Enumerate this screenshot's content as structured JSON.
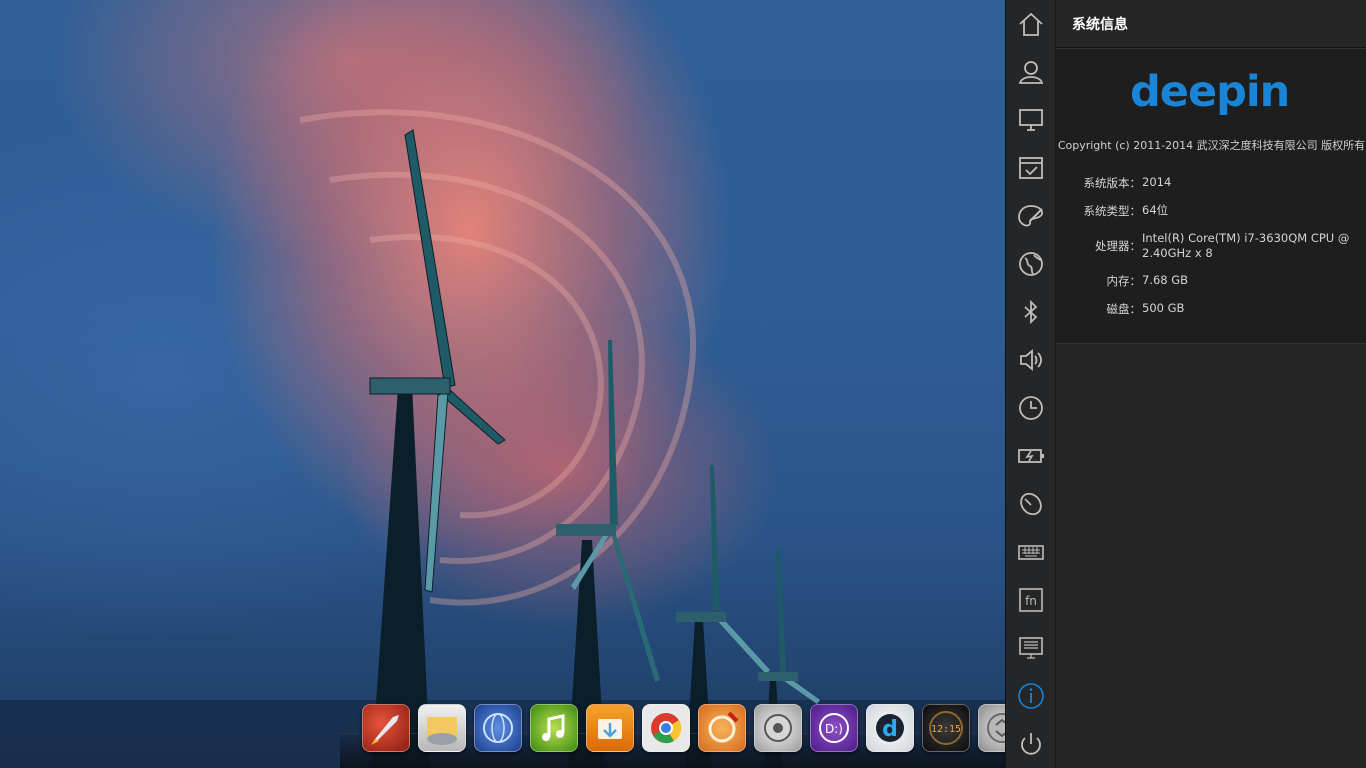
{
  "panel": {
    "title": "系统信息",
    "logo_text": "deepin",
    "copyright": "Copyright (c) 2011-2014 武汉深之度科技有限公司 版权所有",
    "info": [
      {
        "label": "系统版本：",
        "value": "2014"
      },
      {
        "label": "系统类型：",
        "value": "64位"
      },
      {
        "label": "处理器：",
        "value": "Intel(R) Core(TM) i7-3630QM CPU @ 2.40GHz x 8"
      },
      {
        "label": "内存：",
        "value": "7.68 GB"
      },
      {
        "label": "磁盘：",
        "value": "500 GB"
      }
    ]
  },
  "nav_items": [
    {
      "icon": "home-icon"
    },
    {
      "icon": "account-icon"
    },
    {
      "icon": "display-icon"
    },
    {
      "icon": "default-applications-icon"
    },
    {
      "icon": "personalization-icon"
    },
    {
      "icon": "network-icon"
    },
    {
      "icon": "bluetooth-icon"
    },
    {
      "icon": "sound-icon"
    },
    {
      "icon": "date-time-icon"
    },
    {
      "icon": "power-icon"
    },
    {
      "icon": "mouse-icon"
    },
    {
      "icon": "keyboard-icon"
    },
    {
      "icon": "shortcuts-fn-icon"
    },
    {
      "icon": "grub-icon"
    },
    {
      "icon": "system-info-icon",
      "active": true
    },
    {
      "icon": "shutdown-icon"
    }
  ],
  "dock": {
    "apps": [
      {
        "icon": "launcher-rocket-icon"
      },
      {
        "icon": "file-manager-icon"
      },
      {
        "icon": "browser-globe-icon"
      },
      {
        "icon": "music-player-icon"
      },
      {
        "icon": "software-center-icon"
      },
      {
        "icon": "chrome-icon"
      },
      {
        "icon": "deepin-game-icon"
      },
      {
        "icon": "control-center-icon"
      },
      {
        "icon": "deepin-movie-icon"
      },
      {
        "icon": "deepin-terminal-icon"
      },
      {
        "icon": "clock-icon"
      },
      {
        "icon": "trash-icon"
      }
    ],
    "clock_text": "12:15",
    "movie_text": "D:)"
  },
  "colors": {
    "accent": "#1a84d6",
    "nav_bg": "#242628",
    "panel_bg": "#252525"
  }
}
